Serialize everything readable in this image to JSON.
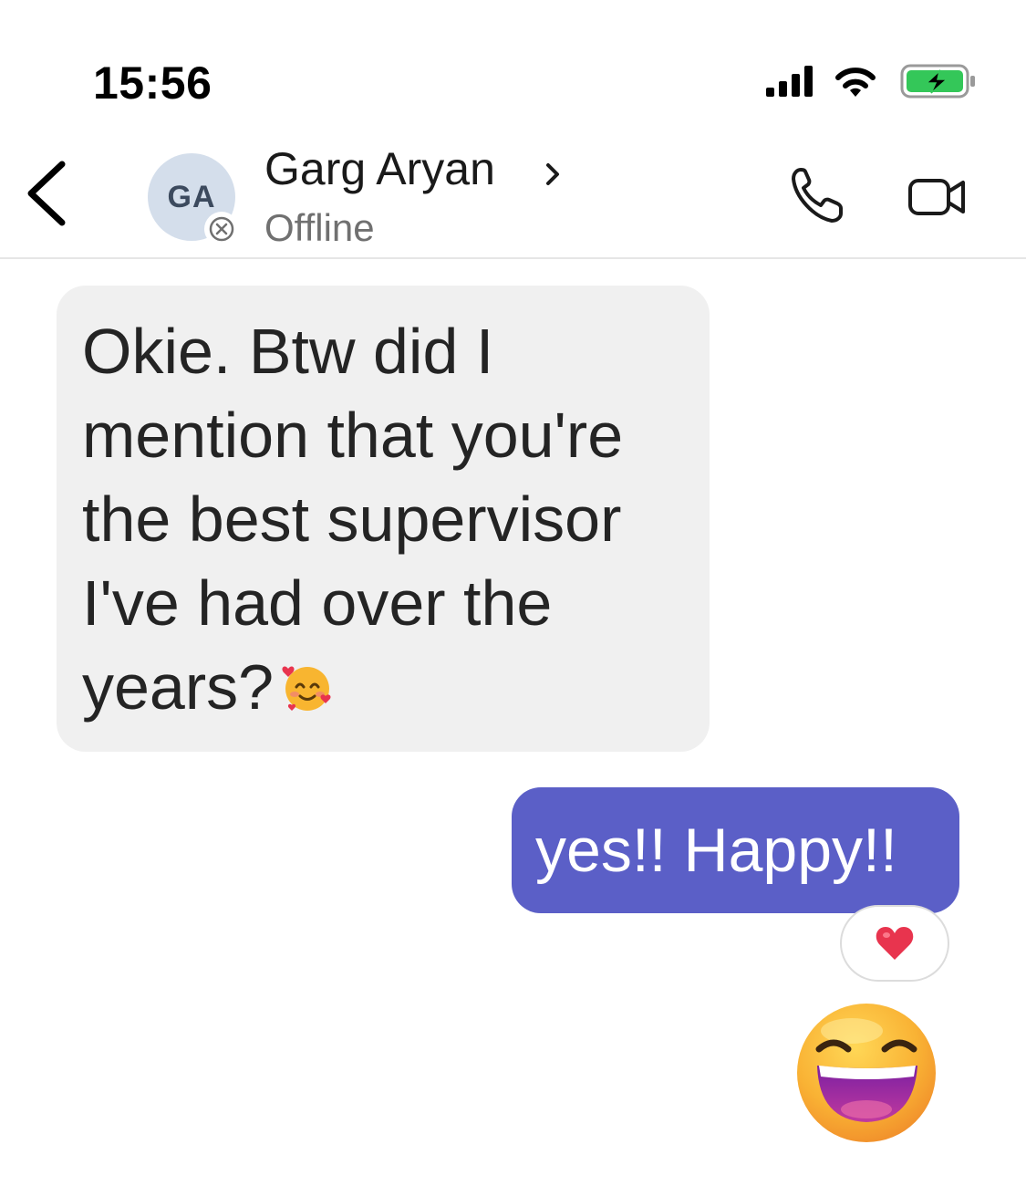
{
  "status_bar": {
    "time": "15:56"
  },
  "header": {
    "avatar_initials": "GA",
    "contact_name": "Garg Aryan",
    "presence_status": "Offline"
  },
  "messages": [
    {
      "direction": "incoming",
      "text": "Okie. Btw did I mention that you're the best supervisor I've had over the years?",
      "emoji": "smiling-face-with-hearts"
    },
    {
      "direction": "outgoing",
      "text": "yes!! Happy!!",
      "reaction": "heart"
    },
    {
      "direction": "outgoing",
      "emoji": "grinning-face-with-smiling-eyes"
    }
  ],
  "colors": {
    "outgoing_bubble": "#5b5fc7",
    "incoming_bubble": "#f0f0f0",
    "avatar_bg": "#d4deeb",
    "battery_charging": "#34c759",
    "reaction_heart": "#e8344e"
  }
}
